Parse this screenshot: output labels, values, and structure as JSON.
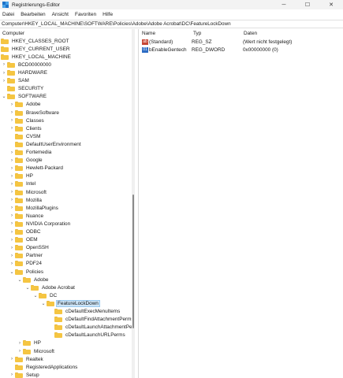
{
  "window": {
    "title": "Registrierungs-Editor",
    "controls": {
      "minimize": "─",
      "maximize": "☐",
      "close": "✕"
    }
  },
  "menu": [
    "Datei",
    "Bearbeiten",
    "Ansicht",
    "Favoriten",
    "Hilfe"
  ],
  "address": "Computer\\HKEY_LOCAL_MACHINE\\SOFTWARE\\Policies\\Adobe\\Adobe Acrobat\\DC\\FeatureLockDown",
  "tree": [
    {
      "label": "Computer",
      "level": 0,
      "chevron": "",
      "icon": "computer"
    },
    {
      "label": "HKEY_CLASSES_ROOT",
      "level": 0,
      "chevron": "",
      "icon": "folder"
    },
    {
      "label": "HKEY_CURRENT_USER",
      "level": 0,
      "chevron": "",
      "icon": "folder"
    },
    {
      "label": "HKEY_LOCAL_MACHINE",
      "level": 0,
      "chevron": "",
      "icon": "folder"
    },
    {
      "label": "BCD00000000",
      "level": 1,
      "chevron": ">",
      "icon": "folder"
    },
    {
      "label": "HARDWARE",
      "level": 1,
      "chevron": ">",
      "icon": "folder"
    },
    {
      "label": "SAM",
      "level": 1,
      "chevron": ">",
      "icon": "folder"
    },
    {
      "label": "SECURITY",
      "level": 1,
      "chevron": "",
      "icon": "folder"
    },
    {
      "label": "SOFTWARE",
      "level": 1,
      "chevron": "v",
      "icon": "folder"
    },
    {
      "label": "Adobe",
      "level": 2,
      "chevron": ">",
      "icon": "folder"
    },
    {
      "label": "BraveSoftware",
      "level": 2,
      "chevron": ">",
      "icon": "folder"
    },
    {
      "label": "Classes",
      "level": 2,
      "chevron": ">",
      "icon": "folder"
    },
    {
      "label": "Clients",
      "level": 2,
      "chevron": ">",
      "icon": "folder"
    },
    {
      "label": "CVSM",
      "level": 2,
      "chevron": "",
      "icon": "folder"
    },
    {
      "label": "DefaultUserEnvironment",
      "level": 2,
      "chevron": "",
      "icon": "folder"
    },
    {
      "label": "Fortemedia",
      "level": 2,
      "chevron": ">",
      "icon": "folder"
    },
    {
      "label": "Google",
      "level": 2,
      "chevron": ">",
      "icon": "folder"
    },
    {
      "label": "Hewlett-Packard",
      "level": 2,
      "chevron": ">",
      "icon": "folder"
    },
    {
      "label": "HP",
      "level": 2,
      "chevron": ">",
      "icon": "folder"
    },
    {
      "label": "Intel",
      "level": 2,
      "chevron": ">",
      "icon": "folder"
    },
    {
      "label": "Microsoft",
      "level": 2,
      "chevron": ">",
      "icon": "folder"
    },
    {
      "label": "Mozilla",
      "level": 2,
      "chevron": ">",
      "icon": "folder"
    },
    {
      "label": "MozillaPlugins",
      "level": 2,
      "chevron": ">",
      "icon": "folder"
    },
    {
      "label": "Nuance",
      "level": 2,
      "chevron": ">",
      "icon": "folder"
    },
    {
      "label": "NVIDIA Corporation",
      "level": 2,
      "chevron": ">",
      "icon": "folder"
    },
    {
      "label": "ODBC",
      "level": 2,
      "chevron": ">",
      "icon": "folder"
    },
    {
      "label": "OEM",
      "level": 2,
      "chevron": ">",
      "icon": "folder"
    },
    {
      "label": "OpenSSH",
      "level": 2,
      "chevron": ">",
      "icon": "folder"
    },
    {
      "label": "Partner",
      "level": 2,
      "chevron": ">",
      "icon": "folder"
    },
    {
      "label": "PDF24",
      "level": 2,
      "chevron": ">",
      "icon": "folder"
    },
    {
      "label": "Policies",
      "level": 2,
      "chevron": "v",
      "icon": "folder"
    },
    {
      "label": "Adobe",
      "level": 3,
      "chevron": "v",
      "icon": "folder"
    },
    {
      "label": "Adobe Acrobat",
      "level": 4,
      "chevron": "v",
      "icon": "folder"
    },
    {
      "label": "DC",
      "level": 5,
      "chevron": "v",
      "icon": "folder"
    },
    {
      "label": "FeatureLockDown",
      "level": 6,
      "chevron": "v",
      "icon": "folder",
      "selected": true
    },
    {
      "label": "cDefaultExecMenuItems",
      "level": 7,
      "chevron": "",
      "icon": "folder"
    },
    {
      "label": "cDefaultFindAttachmentPerms",
      "level": 7,
      "chevron": "",
      "icon": "folder"
    },
    {
      "label": "cDefaultLaunchAttachmentPerms",
      "level": 7,
      "chevron": "",
      "icon": "folder"
    },
    {
      "label": "cDefaultLaunchURLPerms",
      "level": 7,
      "chevron": "",
      "icon": "folder"
    },
    {
      "label": "HP",
      "level": 3,
      "chevron": ">",
      "icon": "folder"
    },
    {
      "label": "Microsoft",
      "level": 3,
      "chevron": ">",
      "icon": "folder"
    },
    {
      "label": "Realtek",
      "level": 2,
      "chevron": ">",
      "icon": "folder"
    },
    {
      "label": "RegisteredApplications",
      "level": 2,
      "chevron": "",
      "icon": "folder"
    },
    {
      "label": "Setup",
      "level": 2,
      "chevron": ">",
      "icon": "folder"
    }
  ],
  "values": {
    "headers": {
      "name": "Name",
      "type": "Typ",
      "data": "Daten"
    },
    "rows": [
      {
        "name": "(Standard)",
        "type": "REG_SZ",
        "data": "(Wert nicht festgelegt)",
        "icon": "string-value-icon",
        "badge": "ab"
      },
      {
        "name": "bEnableGentech",
        "type": "REG_DWORD",
        "data": "0x00000000 (0)",
        "icon": "dword-value-icon",
        "badge": "01"
      }
    ]
  }
}
